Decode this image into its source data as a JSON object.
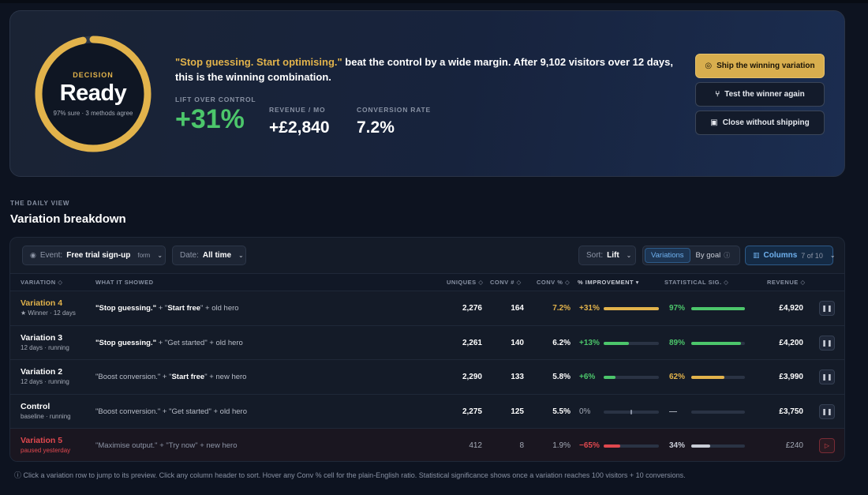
{
  "colors": {
    "gold": "#e2b34b",
    "green": "#4cc66b",
    "red": "#e0484e",
    "blue": "#6fb1ef",
    "bg": "#0d1320"
  },
  "hero": {
    "decision_kicker": "DECISION",
    "decision_state": "Ready",
    "decision_sub": "97% sure · 3 methods agree",
    "confidence": 0.97,
    "headline_quote": "\"Stop guessing. Start optimising.\"",
    "headline_rest": " beat the control by a wide margin. After 9,102 visitors over 12 days, this is the winning combination.",
    "stats": [
      {
        "label": "LIFT OVER CONTROL",
        "value": "+31%"
      },
      {
        "label": "REVENUE / MO",
        "value": "+£2,840"
      },
      {
        "label": "CONVERSION RATE",
        "value": "7.2%"
      }
    ],
    "buttons": {
      "ship": "Ship the winning variation",
      "test_again": "Test the winner again",
      "close": "Close without shipping"
    }
  },
  "section": {
    "kicker": "THE DAILY VIEW",
    "title": "Variation breakdown"
  },
  "toolbar": {
    "event_label": "Event:",
    "event_value": "Free trial sign-up",
    "event_tag": "form",
    "date_label": "Date:",
    "date_value": "All time",
    "sort_label": "Sort:",
    "sort_value": "Lift",
    "view_variations": "Variations",
    "view_by_goal": "By goal",
    "columns_label": "Columns",
    "columns_count": "7 of 10"
  },
  "table": {
    "headers": {
      "variation": "VARIATION ◇",
      "shown": "WHAT IT SHOWED",
      "uniques": "UNIQUES ◇",
      "conv_n": "CONV # ◇",
      "conv_pct": "CONV % ◇",
      "improvement": "% IMPROVEMENT ▾",
      "sig": "STATISTICAL SIG. ◇",
      "revenue": "REVENUE ◇"
    },
    "rows": [
      {
        "name": "Variation 4",
        "sub": "★ Winner · 12 days",
        "style": "gold",
        "shown_a": "\"Stop guessing.\"",
        "shown_b": " + \"",
        "shown_c": "Start free",
        "shown_d": "\" + old hero",
        "bold_a": true,
        "bold_c": true,
        "uniques": "2,276",
        "conv_n": "164",
        "conv_pct": "7.2%",
        "conv_pct_color": "#e2b34b",
        "improvement": "+31%",
        "imp_fill": 1.0,
        "imp_color": "#e2b34b",
        "sig": "97%",
        "sig_fill": 1.0,
        "sig_color": "#4cc66b",
        "revenue": "£4,920",
        "action": "pause"
      },
      {
        "name": "Variation 3",
        "sub": "12 days · running",
        "style": "",
        "shown_a": "\"Stop guessing.\"",
        "shown_b": " + \"",
        "shown_c": "Get started",
        "shown_d": "\" + old hero",
        "bold_a": true,
        "bold_c": false,
        "uniques": "2,261",
        "conv_n": "140",
        "conv_pct": "6.2%",
        "conv_pct_color": "#ffffff",
        "improvement": "+13%",
        "imp_fill": 0.45,
        "imp_color": "#4cc66b",
        "sig": "89%",
        "sig_fill": 0.92,
        "sig_color": "#4cc66b",
        "revenue": "£4,200",
        "action": "pause"
      },
      {
        "name": "Variation 2",
        "sub": "12 days · running",
        "style": "",
        "shown_a": "\"Boost conversion.\"",
        "shown_b": " + \"",
        "shown_c": "Start free",
        "shown_d": "\" + new hero",
        "bold_a": false,
        "bold_c": true,
        "uniques": "2,290",
        "conv_n": "133",
        "conv_pct": "5.8%",
        "conv_pct_color": "#ffffff",
        "improvement": "+6%",
        "imp_fill": 0.21,
        "imp_color": "#4cc66b",
        "sig": "62%",
        "sig_fill": 0.62,
        "sig_color": "#e2b34b",
        "revenue": "£3,990",
        "action": "pause"
      },
      {
        "name": "Control",
        "sub": "baseline · running",
        "style": "",
        "shown_a": "\"Boost conversion.\"",
        "shown_b": " + \"",
        "shown_c": "Get started",
        "shown_d": "\" + old hero",
        "bold_a": false,
        "bold_c": false,
        "uniques": "2,275",
        "conv_n": "125",
        "conv_pct": "5.5%",
        "conv_pct_color": "#ffffff",
        "improvement": "0%",
        "imp_fill": 0.0,
        "imp_color": "#a4aab6",
        "sig": "—",
        "sig_fill": 0.0,
        "sig_color": "#a4aab6",
        "revenue": "£3,750",
        "action": "pause"
      },
      {
        "name": "Variation 5",
        "sub": "paused yesterday",
        "style": "red",
        "shown_a": "\"Maximise output.\"",
        "shown_b": " + \"",
        "shown_c": "Try now",
        "shown_d": "\" + new hero",
        "bold_a": false,
        "bold_c": false,
        "uniques": "412",
        "conv_n": "8",
        "conv_pct": "1.9%",
        "conv_pct_color": "#ffffff",
        "improvement": "−65%",
        "imp_fill": 0.3,
        "imp_color": "#e0484e",
        "sig": "34%",
        "sig_fill": 0.36,
        "sig_color": "#c8ccd6",
        "revenue": "£240",
        "action": "play"
      }
    ]
  },
  "footer": "ⓘ Click a variation row to jump to its preview. Click any column header to sort. Hover any Conv % cell for the plain-English ratio. Statistical significance shows once a variation reaches 100 visitors + 10 conversions."
}
